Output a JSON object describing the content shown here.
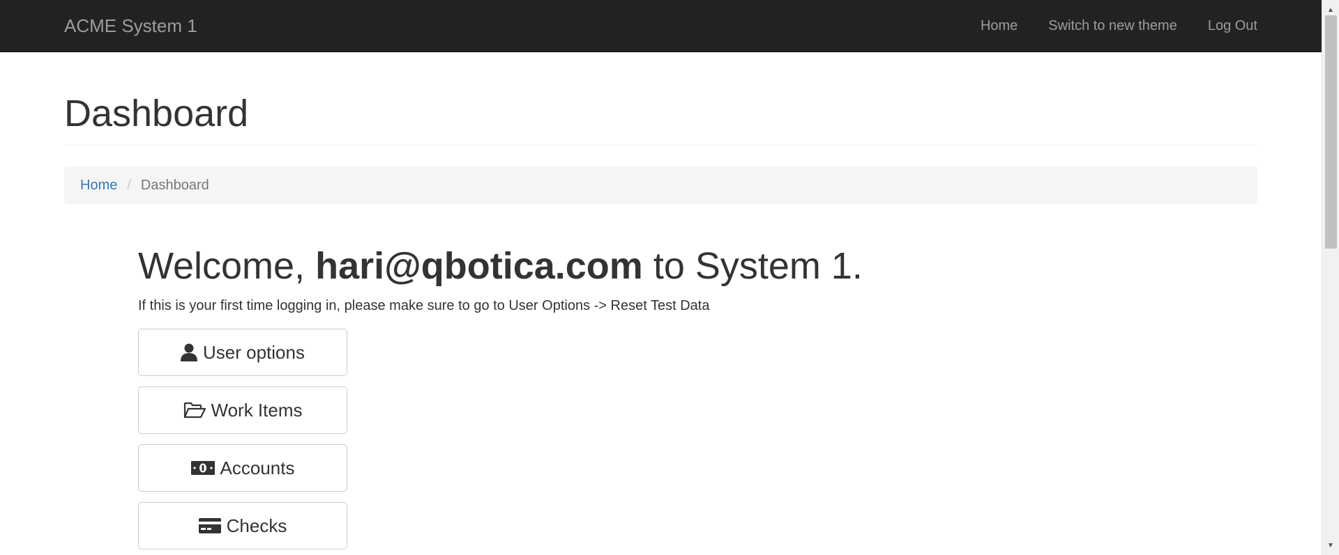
{
  "navbar": {
    "brand": "ACME System 1",
    "links": [
      {
        "label": "Home"
      },
      {
        "label": "Switch to new theme"
      },
      {
        "label": "Log Out"
      }
    ]
  },
  "header": {
    "title": "Dashboard"
  },
  "breadcrumb": {
    "home": "Home",
    "separator": "/",
    "current": "Dashboard"
  },
  "welcome": {
    "prefix": "Welcome, ",
    "user": "hari@qbotica.com",
    "suffix": " to System 1."
  },
  "notice": "If this is your first time logging in, please make sure to go to User Options -> Reset Test Data",
  "buttons": [
    {
      "label": "User options",
      "icon": "user-icon"
    },
    {
      "label": "Work Items",
      "icon": "folder-open-icon"
    },
    {
      "label": "Accounts",
      "icon": "money-icon"
    },
    {
      "label": "Checks",
      "icon": "credit-card-icon"
    }
  ],
  "colors": {
    "navbar_bg": "#222222",
    "navbar_text": "#9d9d9d",
    "link": "#337ab7",
    "breadcrumb_bg": "#f5f5f5"
  }
}
